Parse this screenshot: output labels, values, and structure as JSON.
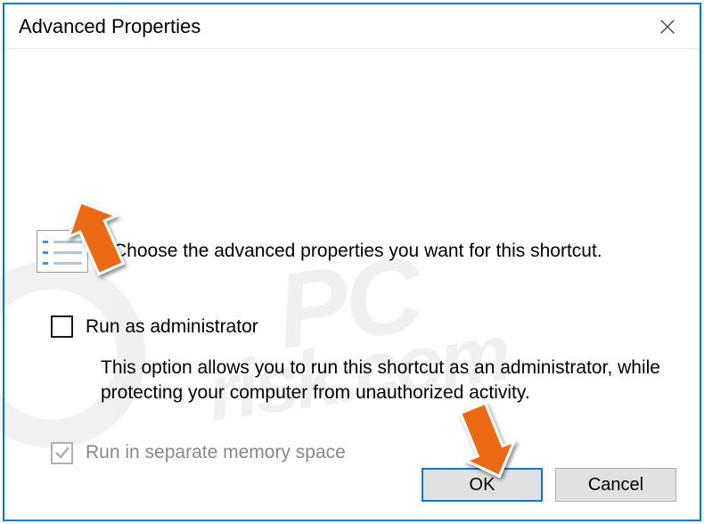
{
  "window": {
    "title": "Advanced Properties"
  },
  "intro": {
    "text": "Choose the advanced properties you want for this shortcut."
  },
  "options": {
    "runAsAdmin": {
      "label": "Run as administrator",
      "description": "This option allows you to run this shortcut as an administrator, while protecting your computer from unauthorized activity."
    },
    "runSeparate": {
      "label": "Run in separate memory space"
    }
  },
  "buttons": {
    "ok": "OK",
    "cancel": "Cancel"
  },
  "watermark": {
    "line1": "PC",
    "line2": "risk.com"
  }
}
